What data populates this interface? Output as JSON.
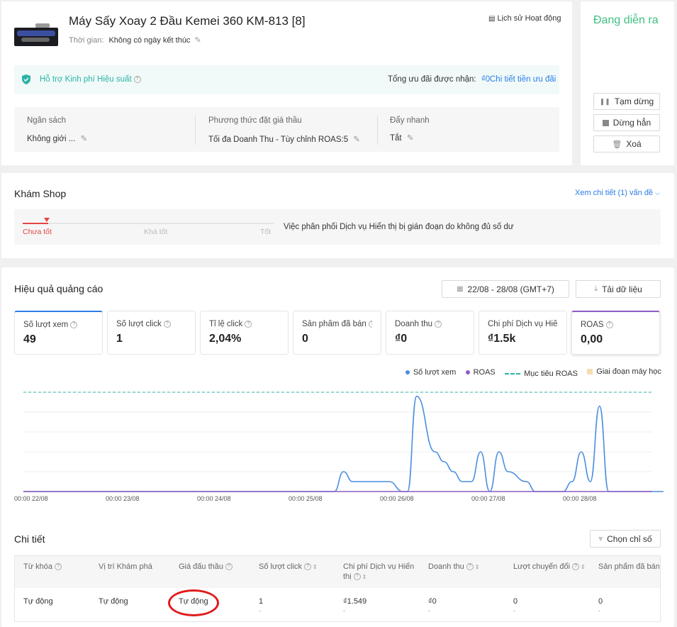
{
  "campaign": {
    "title": "Máy Sấy Xoay 2 Đầu Kemei 360 KM-813 [8]",
    "time_label": "Thời gian:",
    "time_value": "Không có ngày kết thúc",
    "history_link": "Lịch sử Hoạt động",
    "status": "Đang diễn ra",
    "support_label": "Hỗ trợ Kinh phí Hiệu suất",
    "total_discount_label": "Tổng ưu đãi được nhận:",
    "total_discount_value": "₫0",
    "discount_detail_link": "Chi tiết tiền ưu đãi",
    "budget_label": "Ngân sách",
    "budget_value": "Không giới ...",
    "bid_method_label": "Phương thức đặt giá thầu",
    "bid_method_value": "Tối đa Doanh Thu - Tùy chỉnh ROAS:5",
    "boost_label": "Đẩy nhanh",
    "boost_value": "Tắt"
  },
  "actions": {
    "pause": "Tạm dừng",
    "stop": "Dừng hẳn",
    "delete": "Xoá"
  },
  "shop_check": {
    "title": "Khám Shop",
    "detail_link": "Xem chi tiết (1) vấn đề",
    "levels": [
      "Chưa tốt",
      "Khá tốt",
      "Tốt"
    ],
    "message": "Việc phân phối Dịch vụ Hiển thị bị gián đoạn do không đủ số dư"
  },
  "performance": {
    "title": "Hiệu quả quảng cáo",
    "date_range": "22/08 - 28/08 (GMT+7)",
    "download": "Tải dữ liệu",
    "metrics": [
      {
        "label": "Số lượt xem",
        "value": "49"
      },
      {
        "label": "Số lượt click",
        "value": "1"
      },
      {
        "label": "Tỉ lệ click",
        "value": "2,04%"
      },
      {
        "label": "Sản phẩm đã bán",
        "value": "0"
      },
      {
        "label": "Doanh thu",
        "value": "₫0"
      },
      {
        "label": "Chi phí Dịch vụ Hiển thị",
        "value": "₫1.5k"
      },
      {
        "label": "ROAS",
        "value": "0,00"
      }
    ],
    "legend": [
      "Số lượt xem",
      "ROAS",
      "Mục tiêu ROAS",
      "Giai đoạn máy học"
    ],
    "colors": {
      "views": "#4a8ee0",
      "roas": "#8e5cc4",
      "target": "#2bb3a7",
      "learning": "#f5deb0",
      "accent": "#2b7de9",
      "status": "#3fbf7f"
    }
  },
  "chart_data": {
    "type": "line",
    "x_ticks": [
      "00:00 22/08",
      "00:00 23/08",
      "00:00 24/08",
      "00:00 25/08",
      "00:00 26/08",
      "00:00 27/08",
      "00:00 28/08"
    ],
    "series": [
      {
        "name": "Số lượt xem",
        "x": [
          0,
          3.4,
          3.5,
          3.6,
          3.7,
          3.75,
          4.0,
          4.15,
          4.2,
          4.3,
          4.5,
          4.6,
          4.7,
          4.8,
          4.9,
          5.0,
          5.1,
          5.2,
          5.3,
          5.5,
          5.6,
          5.7,
          5.8,
          5.9,
          6.0,
          6.1,
          6.2,
          6.3,
          6.4,
          6.5,
          7.0
        ],
        "y": [
          0,
          0,
          1,
          0.5,
          0.5,
          0.5,
          0.5,
          0,
          0,
          4.8,
          2,
          1.5,
          1,
          0.5,
          0.5,
          2,
          0,
          2,
          1,
          0.5,
          0,
          0,
          0,
          0,
          0.5,
          2,
          0.5,
          4.3,
          0,
          0,
          0
        ]
      },
      {
        "name": "ROAS",
        "x": [
          0,
          7
        ],
        "y": [
          0,
          0
        ]
      }
    ],
    "target_roas_line": true
  },
  "details": {
    "title": "Chi tiết",
    "choose_metrics": "Chọn chỉ số",
    "columns": [
      "Từ khóa",
      "Vị trí Khám phá",
      "Giá đấu thầu",
      "Số lượt click",
      "Chi phí Dịch vụ Hiển thị",
      "Doanh thu",
      "Lượt chuyển đổi",
      "Sản phẩm đã bán"
    ],
    "row": {
      "keyword": "Tự động",
      "position": "Tự động",
      "bid": "Tự động",
      "clicks": "1",
      "cost": "₫1.549",
      "revenue": "₫0",
      "conversions": "0",
      "sold": "0",
      "dash": "-"
    }
  }
}
